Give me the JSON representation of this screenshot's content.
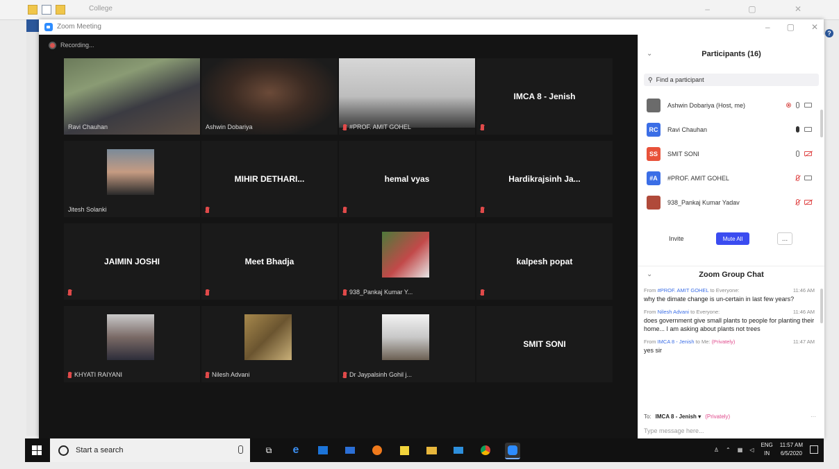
{
  "background_app": {
    "title": "College"
  },
  "zoom": {
    "window_title": "Zoom Meeting",
    "recording": "Recording...",
    "tiles": [
      {
        "name": "Ravi Chauhan",
        "video": true,
        "muted": false,
        "active": true
      },
      {
        "name": "Ashwin Dobariya",
        "video": true,
        "muted": false
      },
      {
        "name": "#PROF. AMIT GOHEL",
        "video": true,
        "muted": true
      },
      {
        "name": "IMCA 8 - Jenish",
        "video": false,
        "muted": true
      },
      {
        "name": "Jitesh Solanki",
        "video": true,
        "muted": false
      },
      {
        "name": "MIHIR DETHARI...",
        "video": false,
        "muted": true
      },
      {
        "name": "hemal vyas",
        "video": false,
        "muted": true
      },
      {
        "name": "Hardikrajsinh Ja...",
        "video": false,
        "muted": true
      },
      {
        "name": "JAIMIN JOSHI",
        "video": false,
        "muted": true
      },
      {
        "name": "Meet Bhadja",
        "video": false,
        "muted": true
      },
      {
        "name": "938_Pankaj Kumar Y...",
        "video": true,
        "muted": true
      },
      {
        "name": "kalpesh popat",
        "video": false,
        "muted": true
      },
      {
        "name": "KHYATI RAIYANI",
        "video": true,
        "muted": true
      },
      {
        "name": "Nilesh Advani",
        "video": true,
        "muted": true
      },
      {
        "name": "Dr Jaypalsinh Gohil j...",
        "video": true,
        "muted": true
      },
      {
        "name": "SMIT SONI",
        "video": false,
        "muted": false
      }
    ]
  },
  "participants": {
    "title": "Participants (16)",
    "search_placeholder": "Find a participant",
    "list": [
      {
        "name": "Ashwin Dobariya (Host, me)",
        "initials": "",
        "color": "#6b6b6b"
      },
      {
        "name": "Ravi Chauhan",
        "initials": "RC",
        "color": "#3b6ee6"
      },
      {
        "name": "SMIT SONI",
        "initials": "SS",
        "color": "#e8523a"
      },
      {
        "name": "#PROF. AMIT GOHEL",
        "initials": "#A",
        "color": "#3b6ee6"
      },
      {
        "name": "938_Pankaj Kumar Yadav",
        "initials": "",
        "color": "#b04a3a"
      }
    ],
    "invite": "Invite",
    "mute_all": "Mute All",
    "more": "..."
  },
  "chat": {
    "title": "Zoom Group Chat",
    "messages": [
      {
        "from_prefix": "From",
        "from": "#PROF. AMIT GOHEL",
        "to_text": "to Everyone:",
        "time": "11:46 AM",
        "text": "why the dimate change is un-certain in last few years?"
      },
      {
        "from_prefix": "From",
        "from": "Nilesh Advani",
        "to_text": "to Everyone:",
        "time": "11:46 AM",
        "text": "does government give small plants to people for planting their home... I am asking about plants not trees"
      },
      {
        "from_prefix": "From",
        "from": "IMCA 8 - Jenish",
        "to_text": "to Me:",
        "private": "(Privately)",
        "time": "11:47 AM",
        "text": "yes sir"
      }
    ],
    "to_label": "To:",
    "to_value": "IMCA 8 - Jenish",
    "to_private": "(Privately)",
    "type_placeholder": "Type message here..."
  },
  "taskbar": {
    "search_placeholder": "Start a search",
    "lang_top": "ENG",
    "lang_bottom": "IN",
    "time": "11:57 AM",
    "date": "6/5/2020"
  }
}
